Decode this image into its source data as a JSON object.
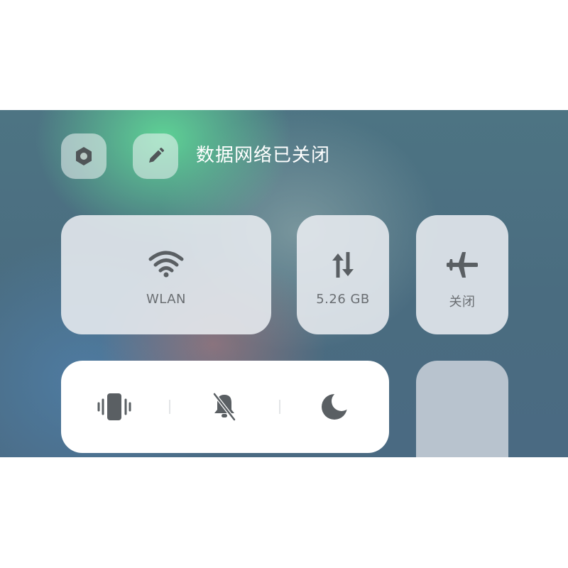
{
  "header": {
    "status_text": "数据网络已关闭",
    "settings_icon": "hexagon-settings-icon",
    "edit_icon": "pencil-edit-icon"
  },
  "tiles": {
    "wlan": {
      "label": "WLAN",
      "icon": "wifi-icon"
    },
    "data": {
      "label": "5.26 GB",
      "icon": "data-transfer-arrows-icon"
    },
    "airplane": {
      "label": "关闭",
      "icon": "airplane-icon"
    }
  },
  "mode_bar": {
    "items": [
      {
        "icon": "vibrate-icon"
      },
      {
        "icon": "bell-muted-icon"
      },
      {
        "icon": "moon-icon"
      }
    ]
  },
  "colors": {
    "tile_bg": "#e8ecf0",
    "icon": "#5a5f63",
    "label": "#6a6e72",
    "status_text": "#ffffff"
  }
}
